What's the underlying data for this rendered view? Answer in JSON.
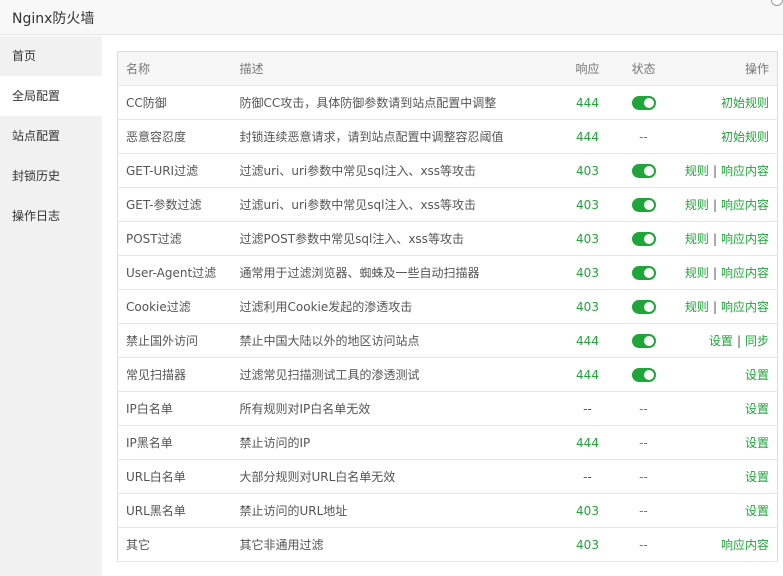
{
  "window": {
    "title": "Nginx防火墙"
  },
  "sidebar": {
    "items": [
      {
        "label": "首页"
      },
      {
        "label": "全局配置"
      },
      {
        "label": "站点配置"
      },
      {
        "label": "封锁历史"
      },
      {
        "label": "操作日志"
      }
    ]
  },
  "table": {
    "headers": {
      "name": "名称",
      "desc": "描述",
      "resp": "响应",
      "state": "状态",
      "op": "操作"
    },
    "rows": [
      {
        "name": "CC防御",
        "desc": "防御CC攻击，具体防御参数请到站点配置中调整",
        "resp": "444",
        "state": "on",
        "ops": [
          "初始规则"
        ]
      },
      {
        "name": "恶意容忍度",
        "desc": "封锁连续恶意请求，请到站点配置中调整容忍阈值",
        "resp": "444",
        "state": "--",
        "ops": [
          "初始规则"
        ]
      },
      {
        "name": "GET-URI过滤",
        "desc": "过滤uri、uri参数中常见sql注入、xss等攻击",
        "resp": "403",
        "state": "on",
        "ops": [
          "规则",
          "响应内容"
        ]
      },
      {
        "name": "GET-参数过滤",
        "desc": "过滤uri、uri参数中常见sql注入、xss等攻击",
        "resp": "403",
        "state": "on",
        "ops": [
          "规则",
          "响应内容"
        ]
      },
      {
        "name": "POST过滤",
        "desc": "过滤POST参数中常见sql注入、xss等攻击",
        "resp": "403",
        "state": "on",
        "ops": [
          "规则",
          "响应内容"
        ]
      },
      {
        "name": "User-Agent过滤",
        "desc": "通常用于过滤浏览器、蜘蛛及一些自动扫描器",
        "resp": "403",
        "state": "on",
        "ops": [
          "规则",
          "响应内容"
        ]
      },
      {
        "name": "Cookie过滤",
        "desc": "过滤利用Cookie发起的渗透攻击",
        "resp": "403",
        "state": "on",
        "ops": [
          "规则",
          "响应内容"
        ]
      },
      {
        "name": "禁止国外访问",
        "desc": "禁止中国大陆以外的地区访问站点",
        "resp": "444",
        "state": "on",
        "ops": [
          "设置",
          "同步"
        ]
      },
      {
        "name": "常见扫描器",
        "desc": "过滤常见扫描测试工具的渗透测试",
        "resp": "444",
        "state": "on",
        "ops": [
          "设置"
        ]
      },
      {
        "name": "IP白名单",
        "desc": "所有规则对IP白名单无效",
        "resp": "--",
        "state": "--",
        "ops": [
          "设置"
        ]
      },
      {
        "name": "IP黑名单",
        "desc": "禁止访问的IP",
        "resp": "444",
        "state": "--",
        "ops": [
          "设置"
        ]
      },
      {
        "name": "URL白名单",
        "desc": "大部分规则对URL白名单无效",
        "resp": "--",
        "state": "--",
        "ops": [
          "设置"
        ]
      },
      {
        "name": "URL黑名单",
        "desc": "禁止访问的URL地址",
        "resp": "403",
        "state": "--",
        "ops": [
          "设置"
        ]
      },
      {
        "name": "其它",
        "desc": "其它非通用过滤",
        "resp": "403",
        "state": "--",
        "ops": [
          "响应内容"
        ]
      }
    ]
  },
  "colors": {
    "accent": "#20a53a",
    "sidebar_bg": "#f1f1f1",
    "header_bg": "#f6f6f6"
  },
  "icons": {
    "toggle": "toggle-switch-icon",
    "close": "close-icon"
  }
}
